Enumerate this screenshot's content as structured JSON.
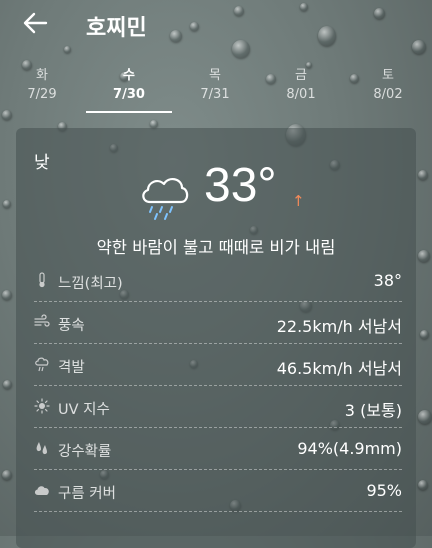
{
  "header": {
    "city": "호찌민"
  },
  "tabs": [
    {
      "dow": "화",
      "date": "7/29"
    },
    {
      "dow": "수",
      "date": "7/30"
    },
    {
      "dow": "목",
      "date": "7/31"
    },
    {
      "dow": "금",
      "date": "8/01"
    },
    {
      "dow": "토",
      "date": "8/02"
    }
  ],
  "active_tab": 1,
  "card": {
    "period": "낮",
    "icon": "cloud-rain-icon",
    "temperature": "33°",
    "trend_arrow": "↑",
    "description": "약한 바람이 불고 때때로 비가 내림",
    "rows": [
      {
        "icon": "thermometer-icon",
        "label": "느낌(최고)",
        "value": "38°"
      },
      {
        "icon": "wind-icon",
        "label": "풍속",
        "value": "22.5km/h 서남서"
      },
      {
        "icon": "gust-icon",
        "label": "격발",
        "value": "46.5km/h 서남서"
      },
      {
        "icon": "sun-icon",
        "label": "UV 지수",
        "value": "3 (보통)"
      },
      {
        "icon": "raindrops-icon",
        "label": "강수확률",
        "value": "94%(4.9mm)"
      },
      {
        "icon": "cloud-icon",
        "label": "구름 커버",
        "value": "95%"
      }
    ]
  },
  "colors": {
    "accent_arrow": "#f28a5a",
    "background": "#6f7b79"
  }
}
